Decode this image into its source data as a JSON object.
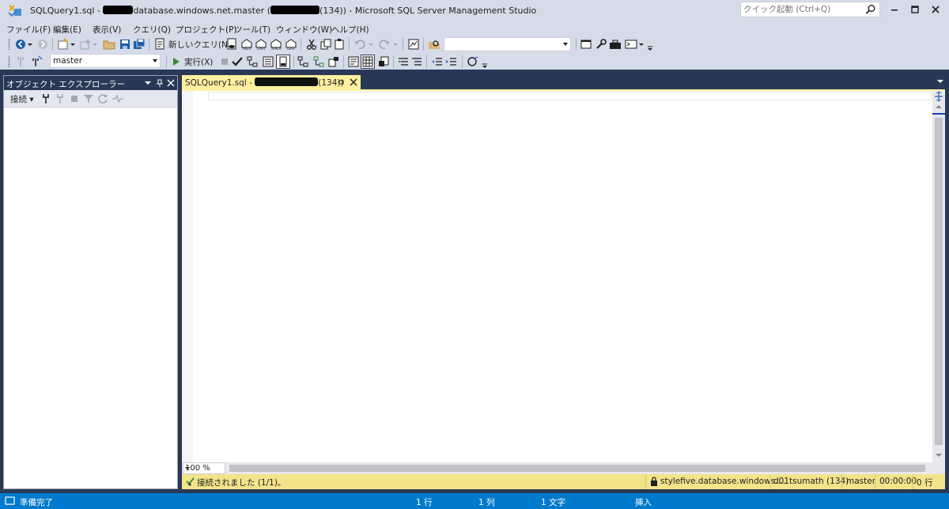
{
  "window": {
    "title_prefix": "SQLQuery1.sql - ",
    "title_middle": "database.windows.net.master (",
    "title_suffix": "(134)) - Microsoft SQL Server Management Studio",
    "quick_launch_placeholder": "クイック起動 (Ctrl+Q)"
  },
  "menu": [
    "ファイル(F)",
    "編集(E)",
    "表示(V)",
    "クエリ(Q)",
    "プロジェクト(P)",
    "ツール(T)",
    "ウィンドウ(W)",
    "ヘルプ(H)"
  ],
  "toolbar1": {
    "new_query_label": "新しいクエリ(N)",
    "solution_config_value": ""
  },
  "toolbar2": {
    "database_value": "master",
    "execute_label": "実行(X)"
  },
  "object_explorer": {
    "title": "オブジェクト エクスプローラー",
    "connect_label": "接続"
  },
  "document_tab": {
    "label_prefix": "SQLQuery1.sql - ",
    "label_suffix": "(134))"
  },
  "editor": {
    "zoom": "100 %"
  },
  "query_status": {
    "message": "接続されました (1/1)。",
    "server": "stylefive.database.windows....",
    "user": "d01tsumath (134)",
    "database": "master",
    "elapsed": "00:00:00",
    "rows": "0 行"
  },
  "status_bar": {
    "ready": "準備完了",
    "line": "1 行",
    "column": "1 列",
    "char": "1 文字",
    "mode": "挿入"
  },
  "colors": {
    "chrome": "#d6dbe9",
    "workarea": "#293955",
    "tab_active": "#fff0a0",
    "query_status": "#f3e48a",
    "status_bar": "#007acc"
  }
}
